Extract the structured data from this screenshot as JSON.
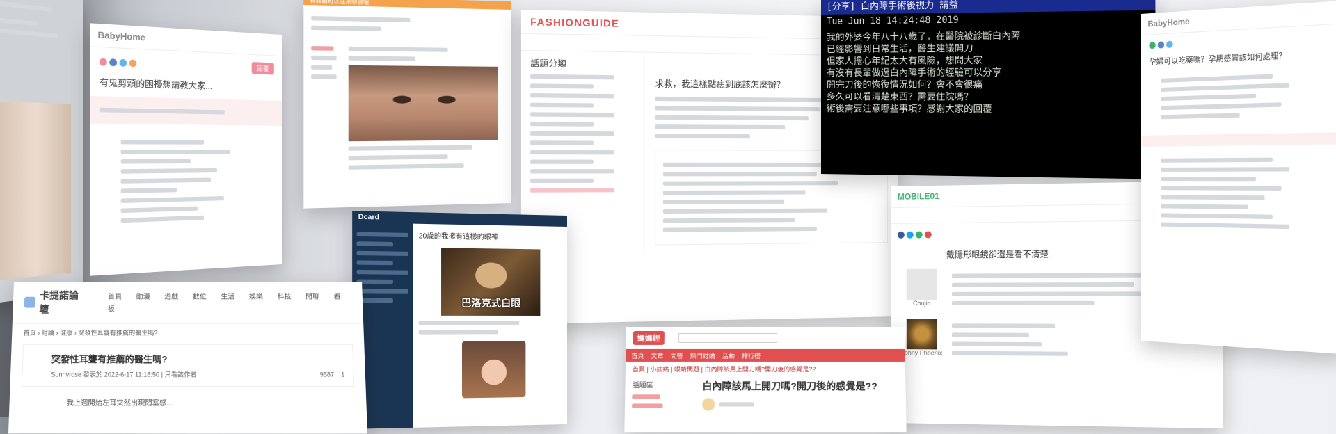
{
  "babyhome_left": {
    "logo": "BabyHome",
    "title": "有鬼剪頭的困擾想請教大家...",
    "reply_btn": "回覆"
  },
  "mobile_post": {
    "header": "有興趣可以進來聊聊喔"
  },
  "fashion": {
    "logo": "FASHIONGUIDE",
    "sidebar_title": "話題分類",
    "post_title": "求救，我這樣點痣到底該怎麼辦？"
  },
  "ptt": {
    "title": "[分享] 白內障手術後視力 請益",
    "date_line": "Tue Jun 18 14:24:48 2019",
    "lines": [
      "我的外婆今年八十八歲了，在醫院被診斷白內障",
      "已經影響到日常生活，醫生建議開刀",
      "但家人擔心年紀太大有風險，想問大家",
      "有沒有長輩做過白內障手術的經驗可以分享",
      "開完刀後的恢復情況如何？會不會很痛",
      "多久可以看清楚東西？需要住院嗎？",
      "術後需要注意哪些事項？感謝大家的回覆"
    ]
  },
  "dcard": {
    "logo": "Dcard",
    "post_title": "20歲的我擁有這樣的眼神",
    "meme_caption": "巴洛克式白眼"
  },
  "kanoshu": {
    "logo": "卡提諾論壇",
    "nav": [
      "首頁",
      "動漫",
      "遊戲",
      "數位",
      "生活",
      "娛樂",
      "科技",
      "閒聊",
      "看板"
    ],
    "breadcrumb": "首頁 › 討論 › 健康 › 突發性耳聾有推薦的醫生嗎?",
    "post_title": "突發性耳聾有推薦的醫生嗎?",
    "post_meta": "Sunnyrose 發表於 2022-6-17 11:18:50 | 只看該作者",
    "views": "9587",
    "reply_count": "1",
    "body": "我上週開始左耳突然出現悶塞感..."
  },
  "mobile01": {
    "logo": "MOBILE01",
    "post_title": "戴隱形眼鏡卻還是看不清楚",
    "user1": "Chujin",
    "user2": "Johny Phoenix"
  },
  "babyhome_right": {
    "logo": "BabyHome",
    "post_title": "孕婦可以吃藥嗎？孕期感冒該如何處理？"
  },
  "pixnet": {
    "logo": "媽媽經",
    "tabs": [
      "首頁",
      "文章",
      "問答",
      "熱門討論",
      "活動",
      "排行榜"
    ],
    "breadcrumb": "首頁 | 小病痛 | 眼睛問題 | 白內障該馬上開刀嗎?開刀後的感覺是??",
    "post_title": "白內障該馬上開刀嗎?開刀後的感覺是??",
    "sidebar_item": "話題區"
  },
  "colors": {
    "dcard_nav": "#1a3553",
    "ptt_bg": "#000000",
    "ptt_title_bg": "#1a2b8f",
    "accent_pink": "#ef8d9c",
    "accent_red": "#e05050",
    "mobile01_green": "#3bb26c"
  }
}
